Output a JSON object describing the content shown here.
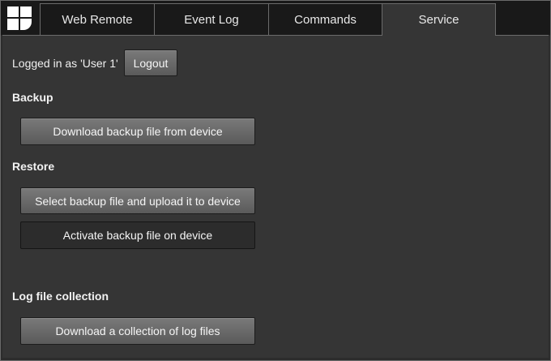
{
  "nav": {
    "logo_icon": "grid-logo-icon",
    "tabs": [
      {
        "label": "Web Remote"
      },
      {
        "label": "Event Log"
      },
      {
        "label": "Commands"
      },
      {
        "label": "Service",
        "active": true
      }
    ]
  },
  "session": {
    "logged_in_text": "Logged in as 'User 1'",
    "logout_label": "Logout"
  },
  "backup": {
    "heading": "Backup",
    "download_label": "Download backup file from device"
  },
  "restore": {
    "heading": "Restore",
    "upload_label": "Select backup file and upload it to device",
    "activate_label": "Activate backup file on device"
  },
  "logs": {
    "heading": "Log file collection",
    "download_label": "Download a collection of log files"
  },
  "colors": {
    "background": "#353535",
    "topbar": "#191919",
    "button": "#6a6a6a"
  }
}
